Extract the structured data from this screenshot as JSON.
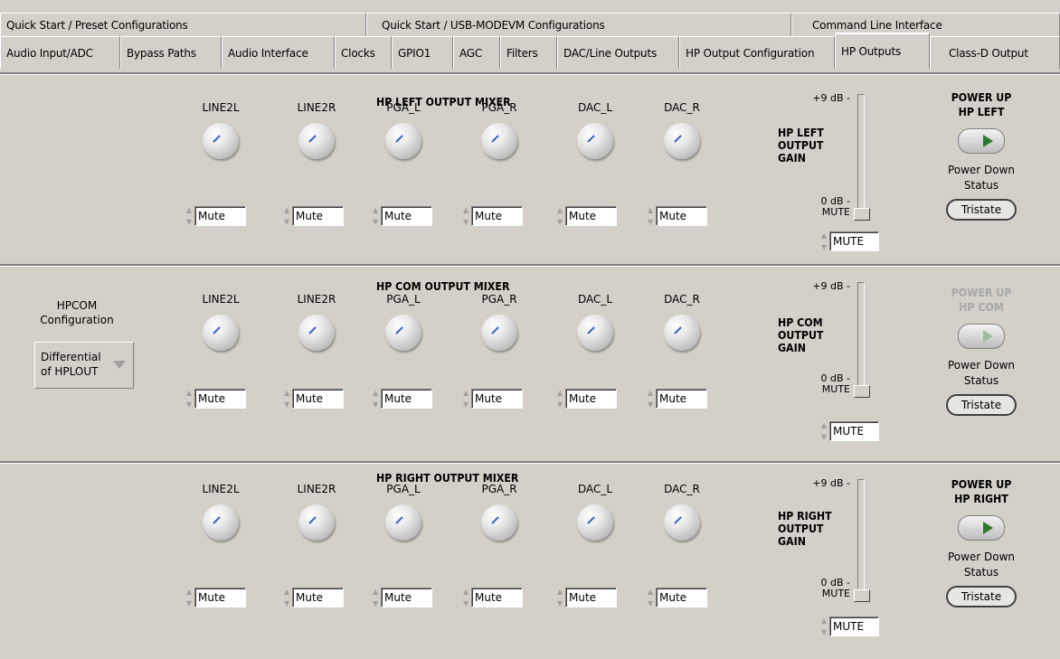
{
  "tabs_row1": [
    "Quick Start / Preset Configurations",
    "Quick Start / USB-MODEVM Configurations",
    "Command Line Interface"
  ],
  "tabs_row2": [
    "Audio Input/ADC",
    "Bypass Paths",
    "Audio Interface",
    "Clocks",
    "GPIO1",
    "AGC",
    "Filters",
    "DAC/Line Outputs",
    "HP Output Configuration",
    "HP Outputs",
    "Class-D Output"
  ],
  "active_tab": "HP Outputs",
  "channel_labels": [
    "LINE2L",
    "LINE2R",
    "PGA_L",
    "PGA_R",
    "DAC_L",
    "DAC_R"
  ],
  "mute_value": "Mute",
  "gain_top": "+9 dB -",
  "gain_bottom": "0 dB -",
  "gain_mute_label": "MUTE",
  "gain_value": "MUTE",
  "power_down_status": "Power Down\nStatus",
  "tristate": "Tristate",
  "sections": {
    "left": {
      "title": "HP LEFT OUTPUT MIXER",
      "gain_label": "HP LEFT\nOUTPUT\nGAIN",
      "power_label": "POWER UP\nHP LEFT"
    },
    "com": {
      "title": "HP COM OUTPUT MIXER",
      "gain_label": "HP COM\nOUTPUT\nGAIN",
      "power_label": "POWER UP\nHP COM",
      "config_label": "HPCOM\nConfiguration",
      "config_value": "Differential\nof HPLOUT"
    },
    "right": {
      "title": "HP RIGHT OUTPUT MIXER",
      "gain_label": "HP RIGHT\nOUTPUT\nGAIN",
      "power_label": "POWER UP\nHP RIGHT"
    }
  }
}
